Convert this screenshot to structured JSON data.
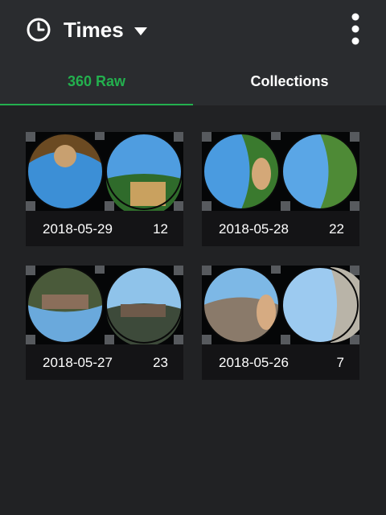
{
  "header": {
    "title": "Times",
    "icons": {
      "left": "clock-icon",
      "dropdown": "caret-down-icon",
      "menu": "more-vertical-icon"
    }
  },
  "tabs": [
    {
      "label": "360 Raw",
      "active": true
    },
    {
      "label": "Collections",
      "active": false
    }
  ],
  "colors": {
    "accent": "#23b04e",
    "background": "#212224",
    "bar": "#2a2c2f",
    "card": "#141416",
    "text": "#ffffff"
  },
  "groups": [
    {
      "date": "2018-05-29",
      "count": "12"
    },
    {
      "date": "2018-05-28",
      "count": "22"
    },
    {
      "date": "2018-05-27",
      "count": "23"
    },
    {
      "date": "2018-05-26",
      "count": "7"
    }
  ]
}
